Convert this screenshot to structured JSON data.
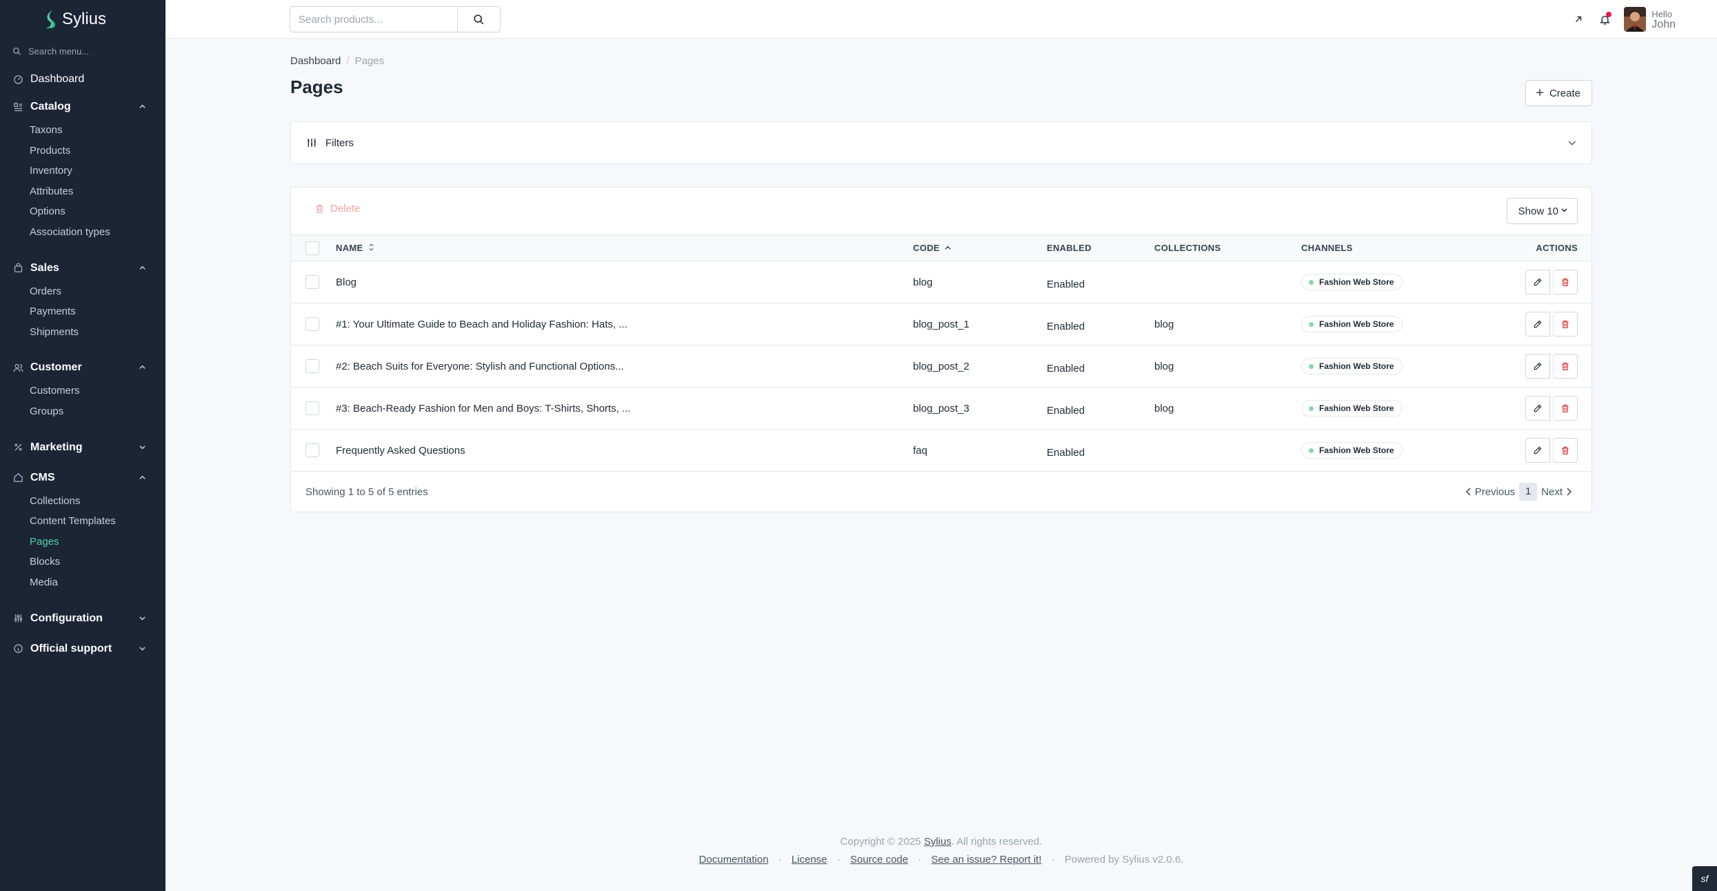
{
  "app": {
    "name": "Sylius",
    "menu_search_placeholder": "Search menu..."
  },
  "topbar": {
    "search_placeholder": "Search products...",
    "user": {
      "greeting": "Hello",
      "name": "John"
    }
  },
  "sidebar": {
    "dashboard": "Dashboard",
    "groups": [
      {
        "label": "Catalog",
        "icon": "catalog-icon",
        "expanded": true,
        "items": [
          "Taxons",
          "Products",
          "Inventory",
          "Attributes",
          "Options",
          "Association types"
        ]
      },
      {
        "label": "Sales",
        "icon": "bag-icon",
        "expanded": true,
        "items": [
          "Orders",
          "Payments",
          "Shipments"
        ]
      },
      {
        "label": "Customer",
        "icon": "users-icon",
        "expanded": true,
        "items": [
          "Customers",
          "Groups"
        ]
      },
      {
        "label": "Marketing",
        "icon": "percent-icon",
        "expanded": false,
        "items": []
      },
      {
        "label": "CMS",
        "icon": "home-icon",
        "expanded": true,
        "items": [
          "Collections",
          "Content Templates",
          "Pages",
          "Blocks",
          "Media"
        ]
      },
      {
        "label": "Configuration",
        "icon": "sliders-icon",
        "expanded": false,
        "items": []
      },
      {
        "label": "Official support",
        "icon": "info-icon",
        "expanded": false,
        "items": []
      }
    ],
    "active_item": "Pages",
    "accent_color": "#4fd1a5"
  },
  "breadcrumb": {
    "root": "Dashboard",
    "current": "Pages"
  },
  "page": {
    "title": "Pages",
    "create_label": "Create"
  },
  "filters": {
    "label": "Filters"
  },
  "grid": {
    "delete_label": "Delete",
    "show_label": "Show 10",
    "columns": {
      "name": "NAME",
      "code": "CODE",
      "enabled": "ENABLED",
      "collections": "COLLECTIONS",
      "channels": "CHANNELS",
      "actions": "ACTIONS"
    },
    "rows": [
      {
        "name": "Blog",
        "code": "blog",
        "enabled": "Enabled",
        "collections": "",
        "channel": "Fashion Web Store"
      },
      {
        "name": "#1: Your Ultimate Guide to Beach and Holiday Fashion: Hats, ...",
        "code": "blog_post_1",
        "enabled": "Enabled",
        "collections": "blog",
        "channel": "Fashion Web Store"
      },
      {
        "name": "#2: Beach Suits for Everyone: Stylish and Functional Options...",
        "code": "blog_post_2",
        "enabled": "Enabled",
        "collections": "blog",
        "channel": "Fashion Web Store"
      },
      {
        "name": "#3: Beach-Ready Fashion for Men and Boys: T-Shirts, Shorts, ...",
        "code": "blog_post_3",
        "enabled": "Enabled",
        "collections": "blog",
        "channel": "Fashion Web Store"
      },
      {
        "name": "Frequently Asked Questions",
        "code": "faq",
        "enabled": "Enabled",
        "collections": "",
        "channel": "Fashion Web Store"
      }
    ],
    "showing": "Showing 1 to 5 of 5 entries",
    "pager": {
      "previous": "Previous",
      "current": "1",
      "next": "Next"
    }
  },
  "footer": {
    "copyright_prefix": "Copyright © 2025",
    "brand_link": "Sylius",
    "copyright_suffix": ". All rights reserved.",
    "links": [
      "Documentation",
      "License",
      "Source code",
      "See an issue? Report it!"
    ],
    "powered": "Powered by Sylius v2.0.6."
  }
}
